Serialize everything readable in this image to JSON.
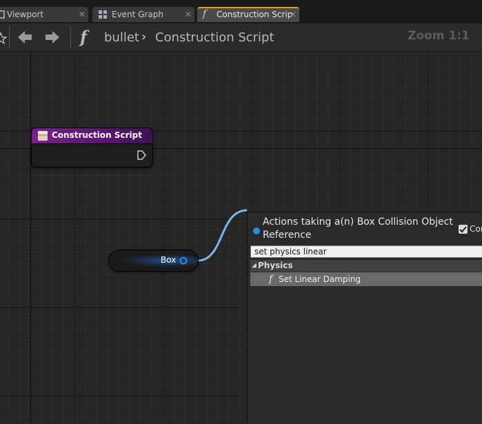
{
  "tabs": [
    {
      "label": "Viewport",
      "icon": "viewport-icon",
      "active": false
    },
    {
      "label": "Event Graph",
      "icon": "event-graph-icon",
      "active": false
    },
    {
      "label": "Construction Scrip",
      "icon": "function-icon",
      "active": true
    }
  ],
  "tab_close": "✕",
  "toolbar": {
    "back_icon": "back-arrow-icon",
    "forward_icon": "forward-arrow-icon",
    "function_glyph": "f",
    "breadcrumb_root": "bullet",
    "breadcrumb_separator": "›",
    "breadcrumb_current": "Construction Script",
    "zoom": "Zoom 1:1"
  },
  "nodes": {
    "construction_script": {
      "title": "Construction Script",
      "header_color": "#6a1a80"
    },
    "box_variable": {
      "label": "Box",
      "pin_color": "#1e90e8"
    }
  },
  "action_menu": {
    "title": "Actions taking a(n) Box Collision Object Reference",
    "context_sensitive_label": "Con",
    "context_sensitive_checked": true,
    "search_value": "set physics linear",
    "category": "Physics",
    "results": [
      {
        "label": "Set Linear Damping",
        "icon": "function-icon"
      }
    ]
  },
  "colors": {
    "wire": "#7ab8f0",
    "accent_tab": "#e0a020"
  }
}
